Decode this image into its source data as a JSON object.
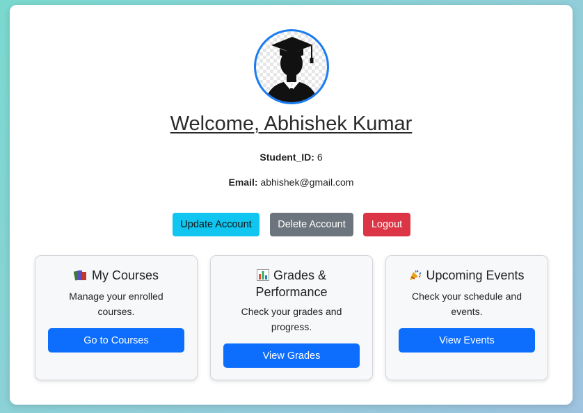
{
  "profile": {
    "welcome": "Welcome, Abhishek Kumar",
    "student_id_label": "Student_ID:",
    "student_id_value": "6",
    "email_label": "Email:",
    "email_value": "abhishek@gmail.com",
    "avatar_icon": "graduate-avatar-icon"
  },
  "actions": {
    "update": "Update Account",
    "delete": "Delete Account",
    "logout": "Logout"
  },
  "panels": [
    {
      "icon": "books-icon",
      "title": "My Courses",
      "desc": "Manage your enrolled courses.",
      "button": "Go to Courses"
    },
    {
      "icon": "bar-chart-icon",
      "title": "Grades & Performance",
      "desc": "Check your grades and progress.",
      "button": "View Grades"
    },
    {
      "icon": "party-popper-icon",
      "title": "Upcoming Events",
      "desc": "Check your schedule and events.",
      "button": "View Events"
    }
  ],
  "colors": {
    "accent": "#0d6efd",
    "update": "#10c5ef",
    "delete": "#6c757d",
    "logout": "#dc3545",
    "avatar_border": "#1a7cf0"
  }
}
